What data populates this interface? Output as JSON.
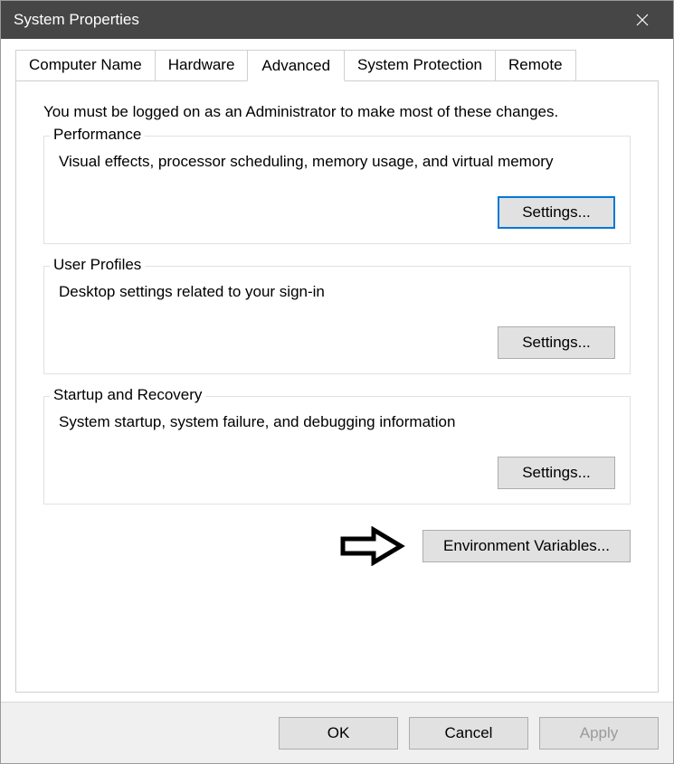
{
  "window": {
    "title": "System Properties"
  },
  "tabs": {
    "computer_name": "Computer Name",
    "hardware": "Hardware",
    "advanced": "Advanced",
    "system_protection": "System Protection",
    "remote": "Remote"
  },
  "content": {
    "intro": "You must be logged on as an Administrator to make most of these changes.",
    "performance": {
      "legend": "Performance",
      "desc": "Visual effects, processor scheduling, memory usage, and virtual memory",
      "settings_label": "Settings..."
    },
    "user_profiles": {
      "legend": "User Profiles",
      "desc": "Desktop settings related to your sign-in",
      "settings_label": "Settings..."
    },
    "startup": {
      "legend": "Startup and Recovery",
      "desc": "System startup, system failure, and debugging information",
      "settings_label": "Settings..."
    },
    "env_vars_label": "Environment Variables..."
  },
  "footer": {
    "ok": "OK",
    "cancel": "Cancel",
    "apply": "Apply"
  }
}
